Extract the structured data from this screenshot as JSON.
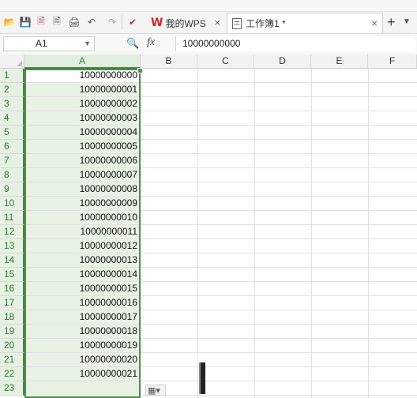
{
  "toolbar": {
    "icons": [
      "open-icon",
      "save-icon",
      "pdf-icon",
      "print-preview-icon",
      "print-icon",
      "undo-icon",
      "redo-icon",
      "format-painter-icon"
    ],
    "tabs": [
      {
        "label": "我的WPS",
        "logo": "W"
      },
      {
        "label": "工作簿1 *"
      }
    ],
    "new_tab": "+",
    "close": "×"
  },
  "formula_bar": {
    "cell_ref": "A1",
    "fx": "fx",
    "value": "10000000000"
  },
  "sheet": {
    "columns": [
      "A",
      "B",
      "C",
      "D",
      "E",
      "F"
    ],
    "rows": [
      {
        "num": "1",
        "a": "10000000000"
      },
      {
        "num": "2",
        "a": "10000000001"
      },
      {
        "num": "3",
        "a": "10000000002"
      },
      {
        "num": "4",
        "a": "10000000003"
      },
      {
        "num": "5",
        "a": "10000000004"
      },
      {
        "num": "6",
        "a": "10000000005"
      },
      {
        "num": "7",
        "a": "10000000006"
      },
      {
        "num": "8",
        "a": "10000000007"
      },
      {
        "num": "9",
        "a": "10000000008"
      },
      {
        "num": "10",
        "a": "10000000009"
      },
      {
        "num": "11",
        "a": "10000000010"
      },
      {
        "num": "12",
        "a": "10000000011"
      },
      {
        "num": "13",
        "a": "10000000012"
      },
      {
        "num": "14",
        "a": "10000000013"
      },
      {
        "num": "15",
        "a": "10000000014"
      },
      {
        "num": "16",
        "a": "10000000015"
      },
      {
        "num": "17",
        "a": "10000000016"
      },
      {
        "num": "18",
        "a": "10000000017"
      },
      {
        "num": "19",
        "a": "10000000018"
      },
      {
        "num": "20",
        "a": "10000000019"
      },
      {
        "num": "21",
        "a": "10000000020"
      },
      {
        "num": "22",
        "a": "10000000021"
      },
      {
        "num": "23",
        "a": ""
      }
    ]
  },
  "colors": {
    "selection": "#4a8f45",
    "selection_fill": "#e8f2e4",
    "wps_red": "#d9251d"
  }
}
